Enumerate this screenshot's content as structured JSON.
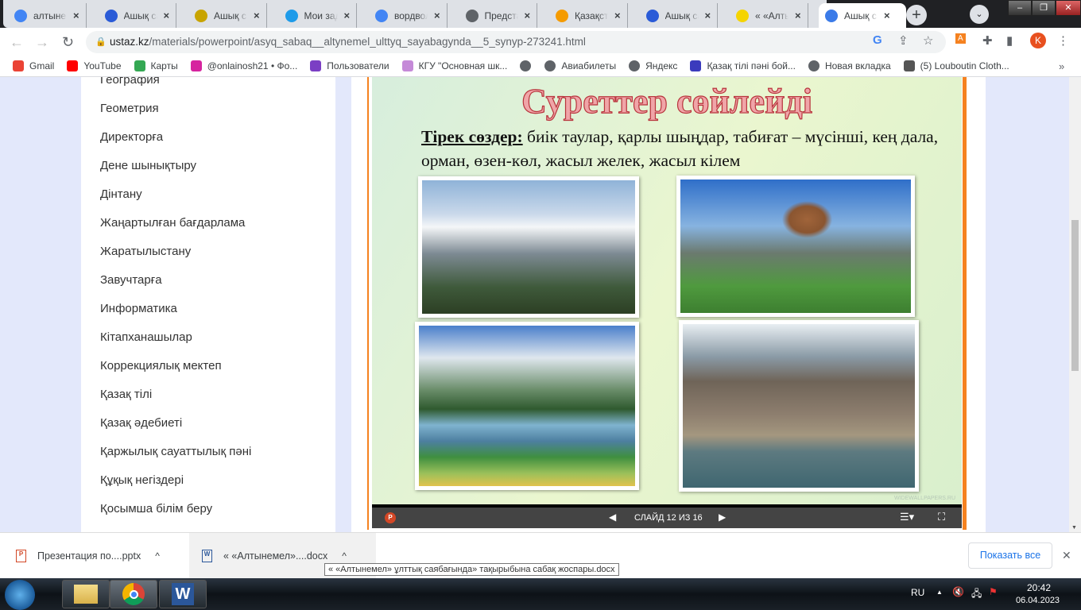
{
  "browser": {
    "tabs": [
      {
        "title": "алтынемел",
        "icon": "google-icon",
        "color": "#4285f4"
      },
      {
        "title": "Ашық сабақ",
        "icon": "ustaz-icon",
        "color": "#2a5bd7"
      },
      {
        "title": "Ашық сабақ",
        "icon": "globe-emblem-icon",
        "color": "#c8a400"
      },
      {
        "title": "Мои задания",
        "icon": "grid-icon",
        "color": "#1e9be9"
      },
      {
        "title": "вордвол",
        "icon": "google-icon",
        "color": "#4285f4"
      },
      {
        "title": "Представление",
        "icon": "globe-icon",
        "color": "#5f6368"
      },
      {
        "title": "Қазақстан",
        "icon": "arch-icon",
        "color": "#f59b00"
      },
      {
        "title": "Ашық сабақ",
        "icon": "ustaz-icon",
        "color": "#2a5bd7"
      },
      {
        "title": "« «Алтынемел»",
        "icon": "bar-icon",
        "color": "#f5d400"
      },
      {
        "title": "алтынемел",
        "icon": "google-icon",
        "color": "#4285f4"
      },
      {
        "title": "Ашық сабақ",
        "icon": "ustaz-circle-icon",
        "color": "#3b7be8"
      }
    ],
    "url_domain": "ustaz.kz",
    "url_path": "/materials/powerpoint/asyq_sabaq__altynemel_ulttyq_sayabagynda__5_synyp-273241.html",
    "profile_initial": "K",
    "bookmarks": [
      {
        "label": "Gmail",
        "color": "#ea4335"
      },
      {
        "label": "YouTube",
        "color": "#ff0000"
      },
      {
        "label": "Карты",
        "color": "#34a853"
      },
      {
        "label": "@onlainosh21 • Фо...",
        "color": "#d6249f"
      },
      {
        "label": "Пользователи",
        "color": "#7b3fc4"
      },
      {
        "label": "КГУ \"Основная шк...",
        "color": "#c58ad8"
      },
      {
        "label": "",
        "color": "#5f6368"
      },
      {
        "label": "Авиабилеты",
        "color": "#5f6368"
      },
      {
        "label": "Яндекс",
        "color": "#5f6368"
      },
      {
        "label": "Қазақ тілі пәні бой...",
        "color": "#3b3bbd"
      },
      {
        "label": "Новая вкладка",
        "color": "#5f6368"
      },
      {
        "label": "(5) Louboutin Cloth...",
        "color": "#555"
      }
    ],
    "more_bookmarks": "»"
  },
  "sidebar": {
    "items": [
      "География",
      "Геометрия",
      "Директорға",
      "Дене шынықтыру",
      "Дінтану",
      "Жаңартылған бағдарлама",
      "Жаратылыстану",
      "Завучтарға",
      "Информатика",
      "Кітапханашылар",
      "Коррекциялық мектеп",
      "Қазақ тілі",
      "Қазақ әдебиеті",
      "Қаржылық сауаттылық пәні",
      "Құқық негіздері",
      "Қосымша білім беру"
    ]
  },
  "slide": {
    "title": "Суреттер сөйлейді",
    "keywords_label": "Тірек сөздер:",
    "keywords_text": " биік таулар, қарлы шыңдар, табиғат – мүсінші, кең дала, орман, өзен-көл, жасыл желек, жасыл кілем",
    "watermark": "WIDEWALLPAPERS.RU"
  },
  "viewer": {
    "slide_label": "СЛАЙД 12 ИЗ 16",
    "current_slide": 12,
    "total_slides": 16,
    "app_icon_letter": "P"
  },
  "downloads": {
    "items": [
      {
        "name": "Презентация по....pptx",
        "icon": "P"
      },
      {
        "name": "« «Алтынемел»....docx",
        "icon": "W"
      }
    ],
    "tooltip": "« «Алтынемел» ұлттық саябағында» тақырыбына сабақ жоспары.docx",
    "show_all": "Показать все"
  },
  "taskbar": {
    "lang": "RU",
    "time": "20:42",
    "date": "06.04.2023"
  }
}
